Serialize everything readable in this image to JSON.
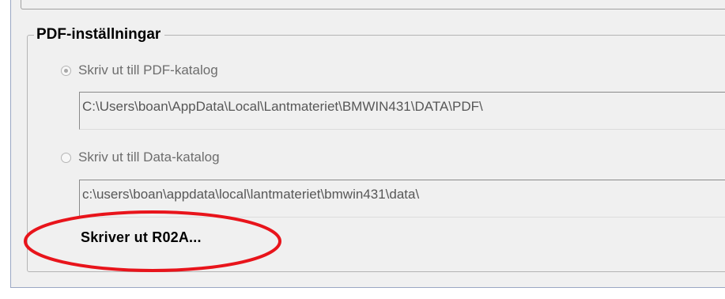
{
  "pdf_settings": {
    "group_title": "PDF-inställningar",
    "option_pdf_folder": {
      "label": "Skriv ut till PDF-katalog",
      "selected": true,
      "path": "C:\\Users\\boan\\AppData\\Local\\Lantmateriet\\BMWIN431\\DATA\\PDF\\"
    },
    "option_data_folder": {
      "label": "Skriv ut till Data-katalog",
      "selected": false,
      "path": "c:\\users\\boan\\appdata\\local\\lantmateriet\\bmwin431\\data\\"
    },
    "status": "Skriver ut R02A..."
  },
  "annotation": {
    "color": "#e8141b"
  }
}
